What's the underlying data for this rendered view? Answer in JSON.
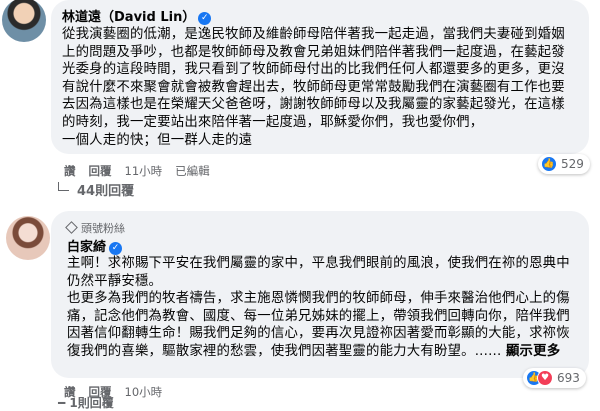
{
  "comments": [
    {
      "author": "林道遠（David Lin）",
      "lines": [
        "從我演藝圈的低潮，是逸民牧師及維齡師母陪伴著我一起走過，當我們夫妻碰到婚姻",
        "上的問題及爭吵，也都是牧師師母及教會兄弟姐妹們陪伴著我們一起度過，在藝起發",
        "光委身的這段時間，我只看到了牧師師母付出的比我們任何人都還要多的更多，更沒",
        "有說什麼不來聚會就會被教會趕出去，牧師師母更常常鼓勵我們在演藝圈有工作也要",
        "去因為這樣也是在榮耀天父爸爸呀，謝謝牧師師母以及我屬靈的家藝起發光，在這樣",
        "的時刻，我一定要站出來陪伴著一起度過，耶穌愛你們，我也愛你們，",
        "一個人走的快；但一群人走的遠"
      ],
      "actions": {
        "like": "讚",
        "reply": "回覆",
        "time": "11小時",
        "edited": "已編輯"
      },
      "reaction_count": "529",
      "view_replies": "44則回覆"
    },
    {
      "badge": "頭號粉絲",
      "author": "白家綺",
      "lines": [
        "主啊！求祢賜下平安在我們屬靈的家中，平息我們眼前的風浪，使我們在祢的恩典中",
        "仍然平靜安穩。",
        "也更多為我們的牧者禱告，求主施恩憐憫我們的牧師師母，伸手來醫治他們心上的傷",
        "痛，記念他們為教會、國度、每一位弟兄姊妹的擺上，帶領我們回轉向你，陪伴我們",
        "因著信仰翻轉生命！賜我們足夠的信心，要再次見證祢因著愛而彰顯的大能，求祢恢",
        "復我們的喜樂，驅散家裡的愁雲，使我們因著聖靈的能力大有盼望。......"
      ],
      "see_more": "顯示更多",
      "actions": {
        "like": "讚",
        "reply": "回覆",
        "time": "10小時"
      },
      "reaction_count": "693"
    }
  ],
  "bottom_partial": "━ 1則回覆"
}
